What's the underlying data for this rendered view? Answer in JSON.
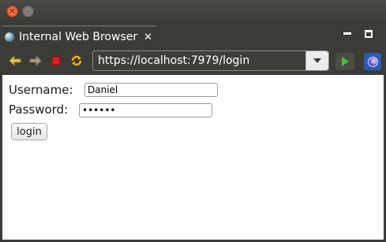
{
  "window": {
    "close_glyph": "×",
    "minimize_glyph": "–"
  },
  "tab": {
    "title": "Internal Web Browser",
    "close_glyph": "✕"
  },
  "toolbar": {
    "url": "https://localhost:7979/login"
  },
  "form": {
    "username_label": "Username:",
    "username_value": "Daniel",
    "password_label": "Password:",
    "password_value": "••••••",
    "login_label": "login"
  },
  "colors": {
    "back_forward": "#e8c25a",
    "stop": "#e02020",
    "refresh": "#f0b000",
    "go": "#3fbf3f"
  }
}
